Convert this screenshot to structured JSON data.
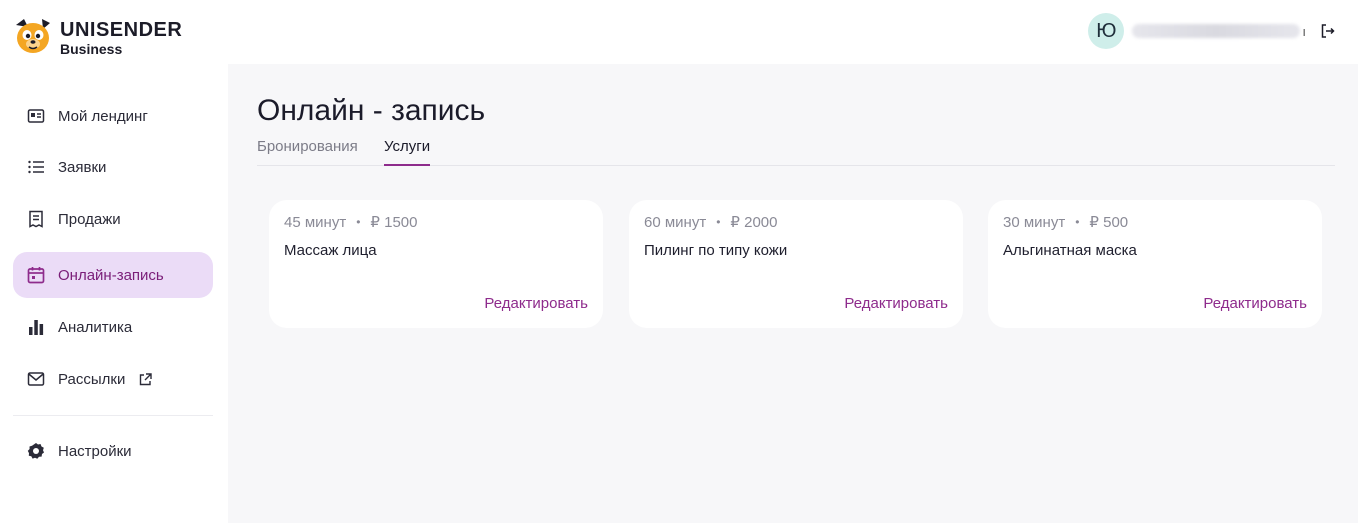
{
  "brand": {
    "line1": "UNISENDER",
    "line2": "Business"
  },
  "user": {
    "avatar_letter": "Ю",
    "email_tail": "ı"
  },
  "sidebar": {
    "items": [
      {
        "label": "Мой лендинг",
        "icon": "landing-icon"
      },
      {
        "label": "Заявки",
        "icon": "list-icon"
      },
      {
        "label": "Продажи",
        "icon": "receipt-icon"
      },
      {
        "label": "Онлайн-запись",
        "icon": "calendar-icon",
        "active": true
      },
      {
        "label": "Аналитика",
        "icon": "bar-chart-icon"
      },
      {
        "label": "Рассылки",
        "icon": "mail-icon",
        "external": true
      },
      {
        "label": "Настройки",
        "icon": "gear-icon"
      }
    ]
  },
  "page": {
    "title": "Онлайн - запись",
    "tabs": [
      {
        "label": "Бронирования",
        "active": false
      },
      {
        "label": "Услуги",
        "active": true
      }
    ]
  },
  "services": [
    {
      "duration": "45 минут",
      "price": "₽ 1500",
      "name": "Массаж лица",
      "edit_label": "Редактировать"
    },
    {
      "duration": "60 минут",
      "price": "₽ 2000",
      "name": "Пилинг по типу кожи",
      "edit_label": "Редактировать"
    },
    {
      "duration": "30 минут",
      "price": "₽ 500",
      "name": "Альгинатная маска",
      "edit_label": "Редактировать"
    }
  ],
  "colors": {
    "accent": "#8e2b8c",
    "active_bg": "#ebdcf7",
    "avatar_bg": "#cfeeea",
    "main_bg": "#f7f7f9"
  }
}
